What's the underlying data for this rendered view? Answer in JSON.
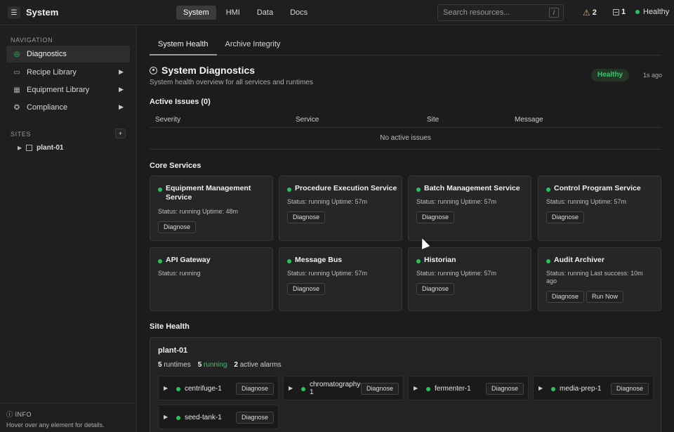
{
  "topbar": {
    "menu_icon": "menu-icon",
    "title": "System",
    "nav": [
      "System",
      "HMI",
      "Data",
      "Docs"
    ],
    "search_placeholder": "Search resources...",
    "search_shortcut": "/",
    "alerts_count": "2",
    "messages_count": "1",
    "health_label": "Healthy"
  },
  "sidebar": {
    "nav_heading": "NAVIGATION",
    "items": [
      {
        "label": "Diagnostics",
        "icon": "target-icon"
      },
      {
        "label": "Recipe Library",
        "icon": "book-icon"
      },
      {
        "label": "Equipment Library",
        "icon": "equipment-icon"
      },
      {
        "label": "Compliance",
        "icon": "badge-icon"
      }
    ],
    "sites_heading": "SITES",
    "sites_add": "+",
    "site": "plant-01",
    "info_title": "INFO",
    "info_text": "Hover over any element for details."
  },
  "tabs": [
    "System Health",
    "Archive Integrity"
  ],
  "header": {
    "title": "System Diagnostics",
    "subtitle": "System health overview for all services and runtimes",
    "badge": "Healthy",
    "updated": "1s ago"
  },
  "issues": {
    "title": "Active Issues (0)",
    "columns": [
      "Severity",
      "Service",
      "Site",
      "Message"
    ],
    "empty": "No active issues"
  },
  "services": {
    "title": "Core Services",
    "items": [
      {
        "name": "Equipment Management Service",
        "meta": "Status: running   Uptime: 48m",
        "buttons": [
          "Diagnose"
        ]
      },
      {
        "name": "Procedure Execution Service",
        "meta": "Status: running   Uptime: 57m",
        "buttons": [
          "Diagnose"
        ]
      },
      {
        "name": "Batch Management Service",
        "meta": "Status: running   Uptime: 57m",
        "buttons": [
          "Diagnose"
        ]
      },
      {
        "name": "Control Program Service",
        "meta": "Status: running   Uptime: 57m",
        "buttons": [
          "Diagnose"
        ]
      },
      {
        "name": "API Gateway",
        "meta": "Status: running",
        "buttons": []
      },
      {
        "name": "Message Bus",
        "meta": "Status: running   Uptime: 57m",
        "buttons": [
          "Diagnose"
        ]
      },
      {
        "name": "Historian",
        "meta": "Status: running   Uptime: 57m",
        "buttons": [
          "Diagnose"
        ]
      },
      {
        "name": "Audit Archiver",
        "meta": "Status: running   Last success: 10m ago",
        "buttons": [
          "Diagnose",
          "Run Now"
        ]
      }
    ]
  },
  "site_health": {
    "title": "Site Health",
    "site": "plant-01",
    "runtimes_count": "5",
    "runtimes_label": "runtimes",
    "running_count": "5",
    "running_label": "running",
    "alarms_count": "2",
    "alarms_label": "active alarms",
    "runtimes": [
      {
        "name": "centrifuge-1",
        "button": "Diagnose"
      },
      {
        "name": "chromatography-1",
        "button": "Diagnose"
      },
      {
        "name": "fermenter-1",
        "button": "Diagnose"
      },
      {
        "name": "media-prep-1",
        "button": "Diagnose"
      },
      {
        "name": "seed-tank-1",
        "button": "Diagnose"
      }
    ]
  },
  "colors": {
    "accent_green": "#22c55e",
    "warning": "#e8b84a"
  }
}
